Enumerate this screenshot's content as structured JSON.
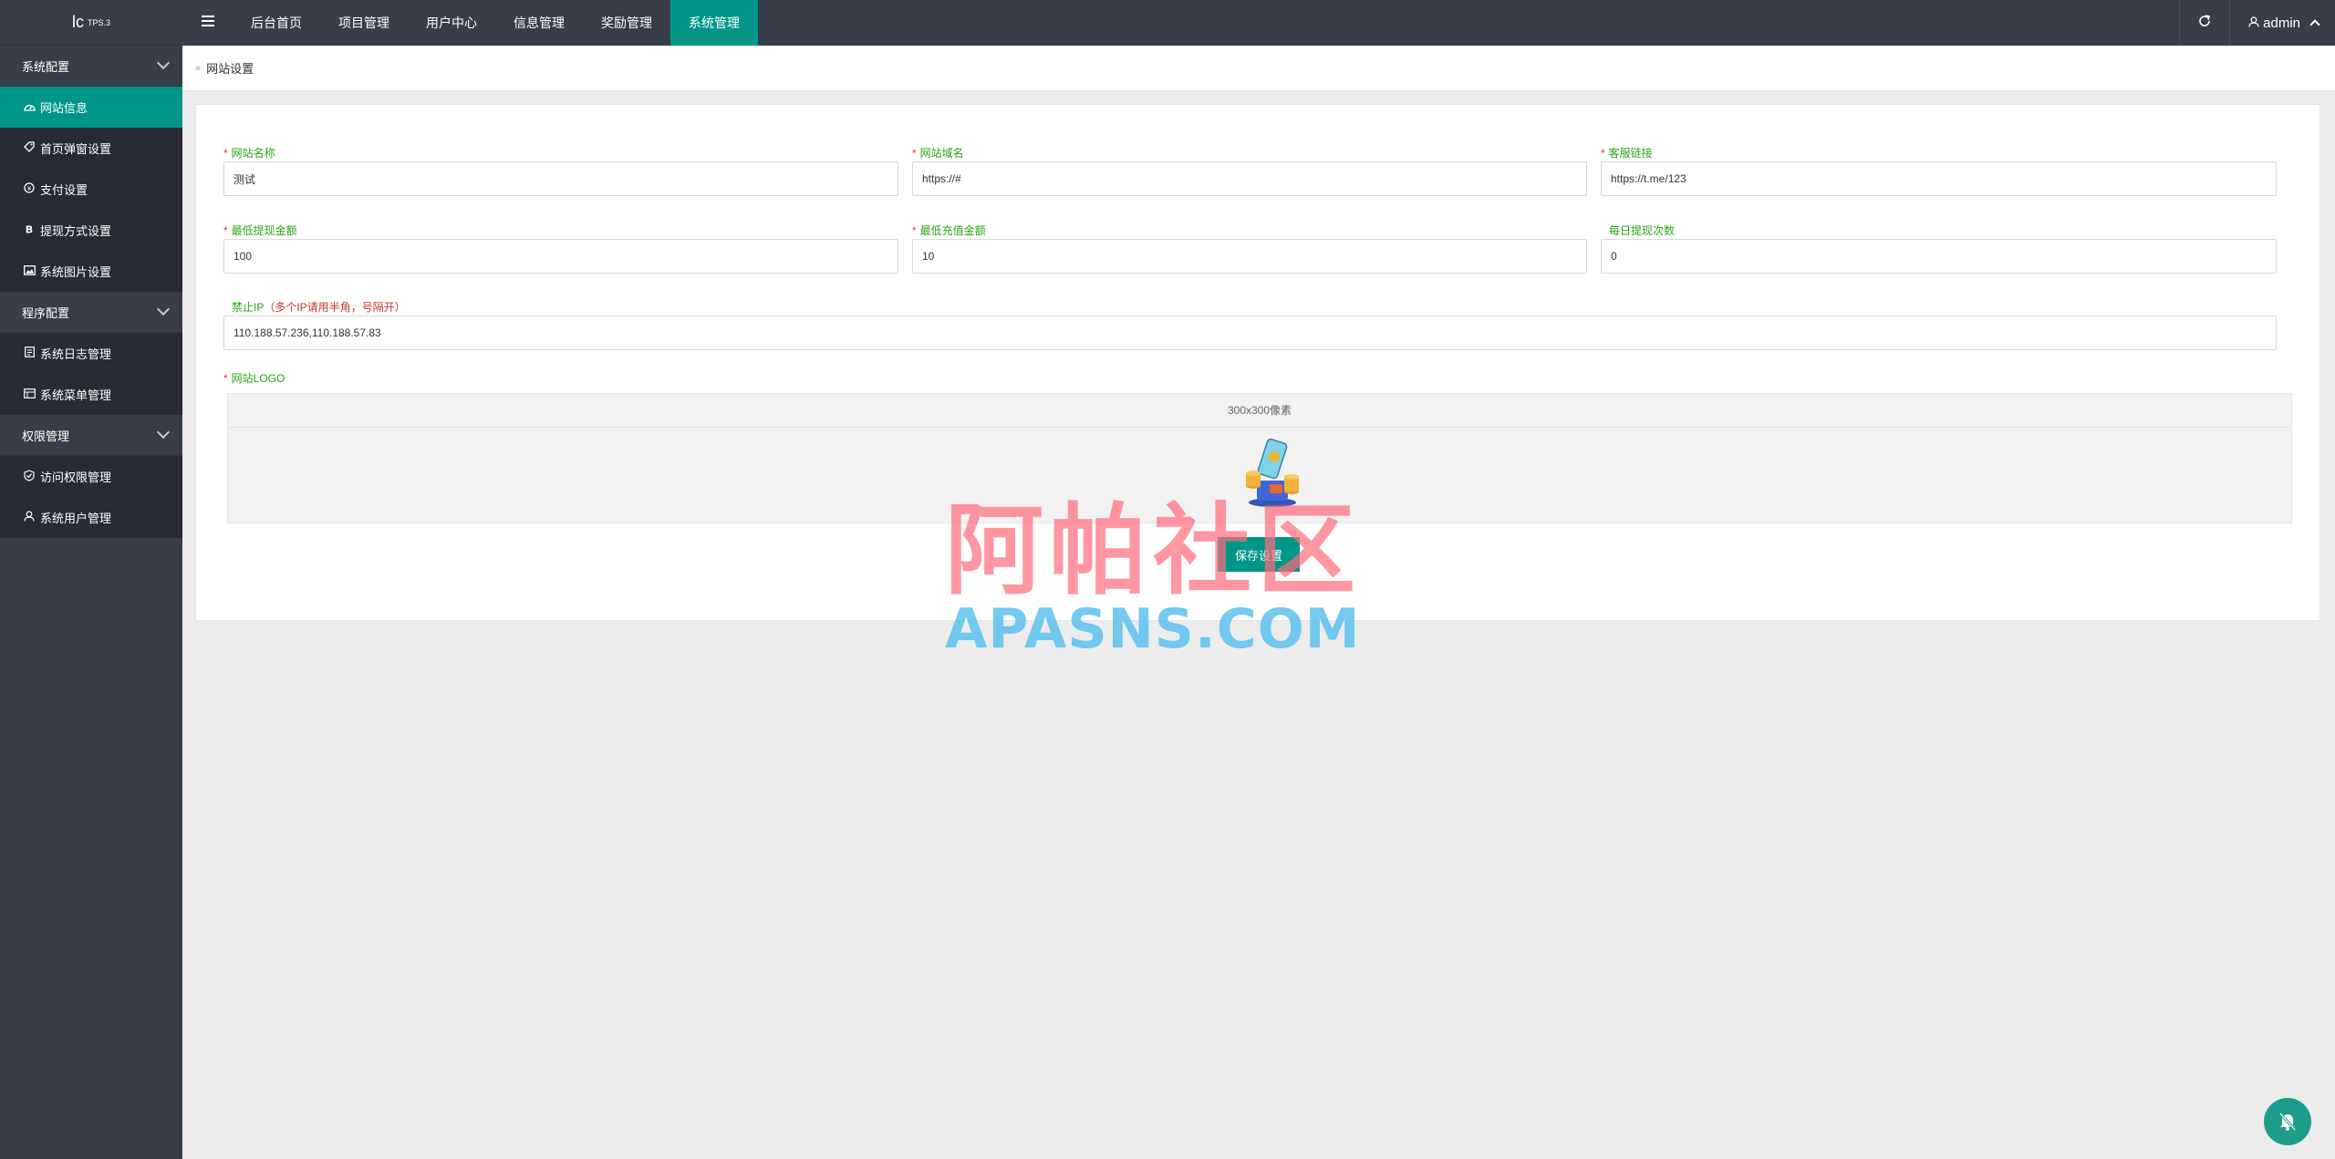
{
  "app": {
    "logo_text": "lc",
    "logo_version": "TPS.3"
  },
  "sidebar": {
    "groups": [
      {
        "label": "系统配置",
        "items": [
          {
            "label": "网站信息",
            "icon": "dashboard-icon",
            "active": true
          },
          {
            "label": "首页弹窗设置",
            "icon": "tag-icon"
          },
          {
            "label": "支付设置",
            "icon": "pay-icon"
          },
          {
            "label": "提现方式设置",
            "icon": "bitcoin-icon"
          },
          {
            "label": "系统图片设置",
            "icon": "image-icon"
          }
        ]
      },
      {
        "label": "程序配置",
        "items": [
          {
            "label": "系统日志管理",
            "icon": "log-icon"
          },
          {
            "label": "系统菜单管理",
            "icon": "menu-icon"
          }
        ]
      },
      {
        "label": "权限管理",
        "items": [
          {
            "label": "访问权限管理",
            "icon": "shield-icon"
          },
          {
            "label": "系统用户管理",
            "icon": "user-icon"
          }
        ]
      }
    ]
  },
  "topnav": {
    "items": [
      "后台首页",
      "项目管理",
      "用户中心",
      "信息管理",
      "奖励管理",
      "系统管理"
    ],
    "active_index": 5,
    "user": "admin"
  },
  "breadcrumb": {
    "current": "网站设置"
  },
  "form": {
    "site_name": {
      "label": "网站名称",
      "value": "测试"
    },
    "site_domain": {
      "label": "网站域名",
      "value": "https://#"
    },
    "service_link": {
      "label": "客服链接",
      "value": "https://t.me/123"
    },
    "min_withdraw": {
      "label": "最低提现金额",
      "value": "100"
    },
    "min_recharge": {
      "label": "最低充值金额",
      "value": "10"
    },
    "daily_withdraw_times": {
      "label": "每日提现次数",
      "value": "0"
    },
    "banned_ip": {
      "label": "禁止IP",
      "hint": "（多个IP请用半角，号隔开）",
      "value": "110.188.57.236,110.188.57.83"
    },
    "logo": {
      "label": "网站LOGO",
      "tip": "300x300像素"
    },
    "save_label": "保存设置"
  },
  "watermark": {
    "cn": "阿帕社区",
    "en": "APASNS.COM"
  },
  "colors": {
    "primary": "#009688",
    "sidebar_bg": "#393d49",
    "submenu_bg": "#282b33",
    "label_green": "#2aa516",
    "required_red": "#e33333"
  }
}
